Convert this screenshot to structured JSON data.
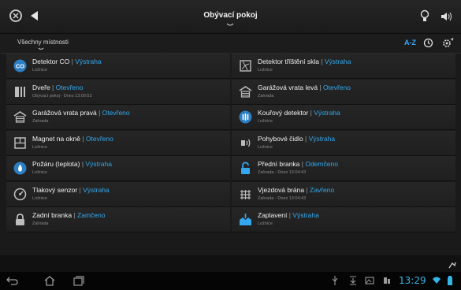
{
  "header": {
    "title": "Obývací pokoj"
  },
  "filter": {
    "room": "Všechny místnosti",
    "sort": "A-Z"
  },
  "devices_left": [
    {
      "name": "Detektor CO",
      "state": "Výstraha",
      "sub": "Ložnice",
      "icon": "co-detector-icon"
    },
    {
      "name": "Dveře",
      "state": "Otevřeno",
      "sub": "Obývací pokoj - Dnes 13:09:53",
      "icon": "door-icon"
    },
    {
      "name": "Garážová vrata pravá",
      "state": "Otevřeno",
      "sub": "Zahrada",
      "icon": "garage-icon"
    },
    {
      "name": "Magnet na okně",
      "state": "Otevřeno",
      "sub": "Ložnice",
      "icon": "window-magnet-icon"
    },
    {
      "name": "Požáru (teplota)",
      "state": "Výstraha",
      "sub": "Ložnice",
      "icon": "fire-icon"
    },
    {
      "name": "Tlakový senzor",
      "state": "Výstraha",
      "sub": "Ložnice",
      "icon": "pressure-gauge-icon"
    },
    {
      "name": "Zadní branka",
      "state": "Zamčeno",
      "sub": "Zahrada",
      "icon": "lock-icon"
    }
  ],
  "devices_right": [
    {
      "name": "Detektor tříštění skla",
      "state": "Výstraha",
      "sub": "Ložnice",
      "icon": "glass-break-icon"
    },
    {
      "name": "Garážová vrata levá",
      "state": "Otevřeno",
      "sub": "Zahrada",
      "icon": "garage-icon"
    },
    {
      "name": "Kouřový detektor",
      "state": "Výstraha",
      "sub": "Ložnice",
      "icon": "smoke-detector-icon"
    },
    {
      "name": "Pohybové čidlo",
      "state": "Výstraha",
      "sub": "Ložnice",
      "icon": "motion-sensor-icon"
    },
    {
      "name": "Přední branka",
      "state": "Odemčeno",
      "sub": "Zahrada - Dnes 13:04:43",
      "icon": "unlock-icon"
    },
    {
      "name": "Vjezdová brána",
      "state": "Zavřeno",
      "sub": "Zahrada - Dnes 13:04:43",
      "icon": "gate-icon"
    },
    {
      "name": "Zaplavení",
      "state": "Výstraha",
      "sub": "Ložnice",
      "icon": "flood-icon"
    }
  ],
  "status": {
    "clock": "13:29"
  },
  "colors": {
    "accent": "#33a8ee",
    "background": "#1a1a1a"
  }
}
